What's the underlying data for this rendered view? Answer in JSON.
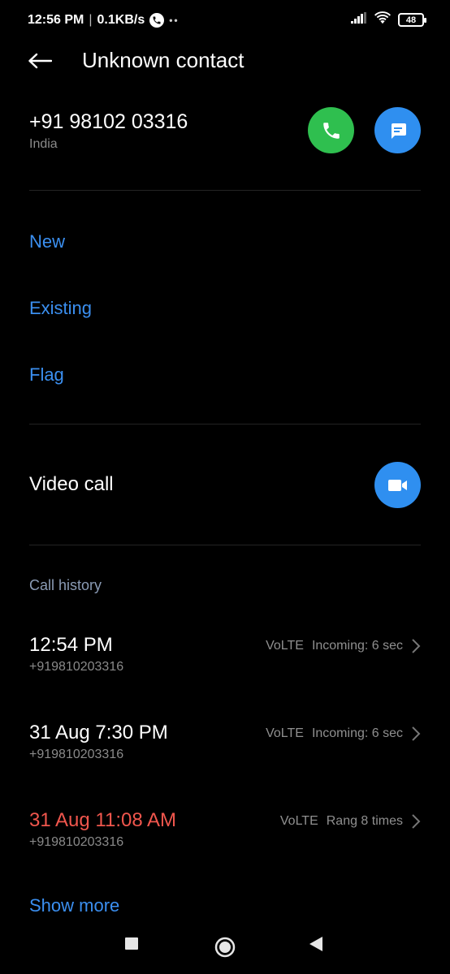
{
  "status_bar": {
    "time": "12:56 PM",
    "speed": "0.1KB/s",
    "battery": "48",
    "icons": [
      "phone-call-icon",
      "signal-icon",
      "wifi-icon",
      "battery-icon"
    ]
  },
  "header": {
    "title": "Unknown contact",
    "back_icon": "back-arrow-icon"
  },
  "contact": {
    "number": "+91 98102 03316",
    "country": "India"
  },
  "actions": {
    "items": [
      "New",
      "Existing",
      "Flag"
    ]
  },
  "video": {
    "label": "Video call"
  },
  "history": {
    "title": "Call history",
    "items": [
      {
        "time": "12:54 PM",
        "number": "+919810203316",
        "network": "VoLTE",
        "status": "Incoming: 6 sec",
        "missed": false
      },
      {
        "time": "31 Aug 7:30 PM",
        "number": "+919810203316",
        "network": "VoLTE",
        "status": "Incoming: 6 sec",
        "missed": false
      },
      {
        "time": "31 Aug 11:08 AM",
        "number": "+919810203316",
        "network": "VoLTE",
        "status": "Rang 8 times",
        "missed": true
      }
    ],
    "show_more": "Show more"
  },
  "colors": {
    "accent": "#3b8ff0",
    "call_green": "#2fbf4f",
    "missed_red": "#f0564d",
    "background": "#000000"
  }
}
